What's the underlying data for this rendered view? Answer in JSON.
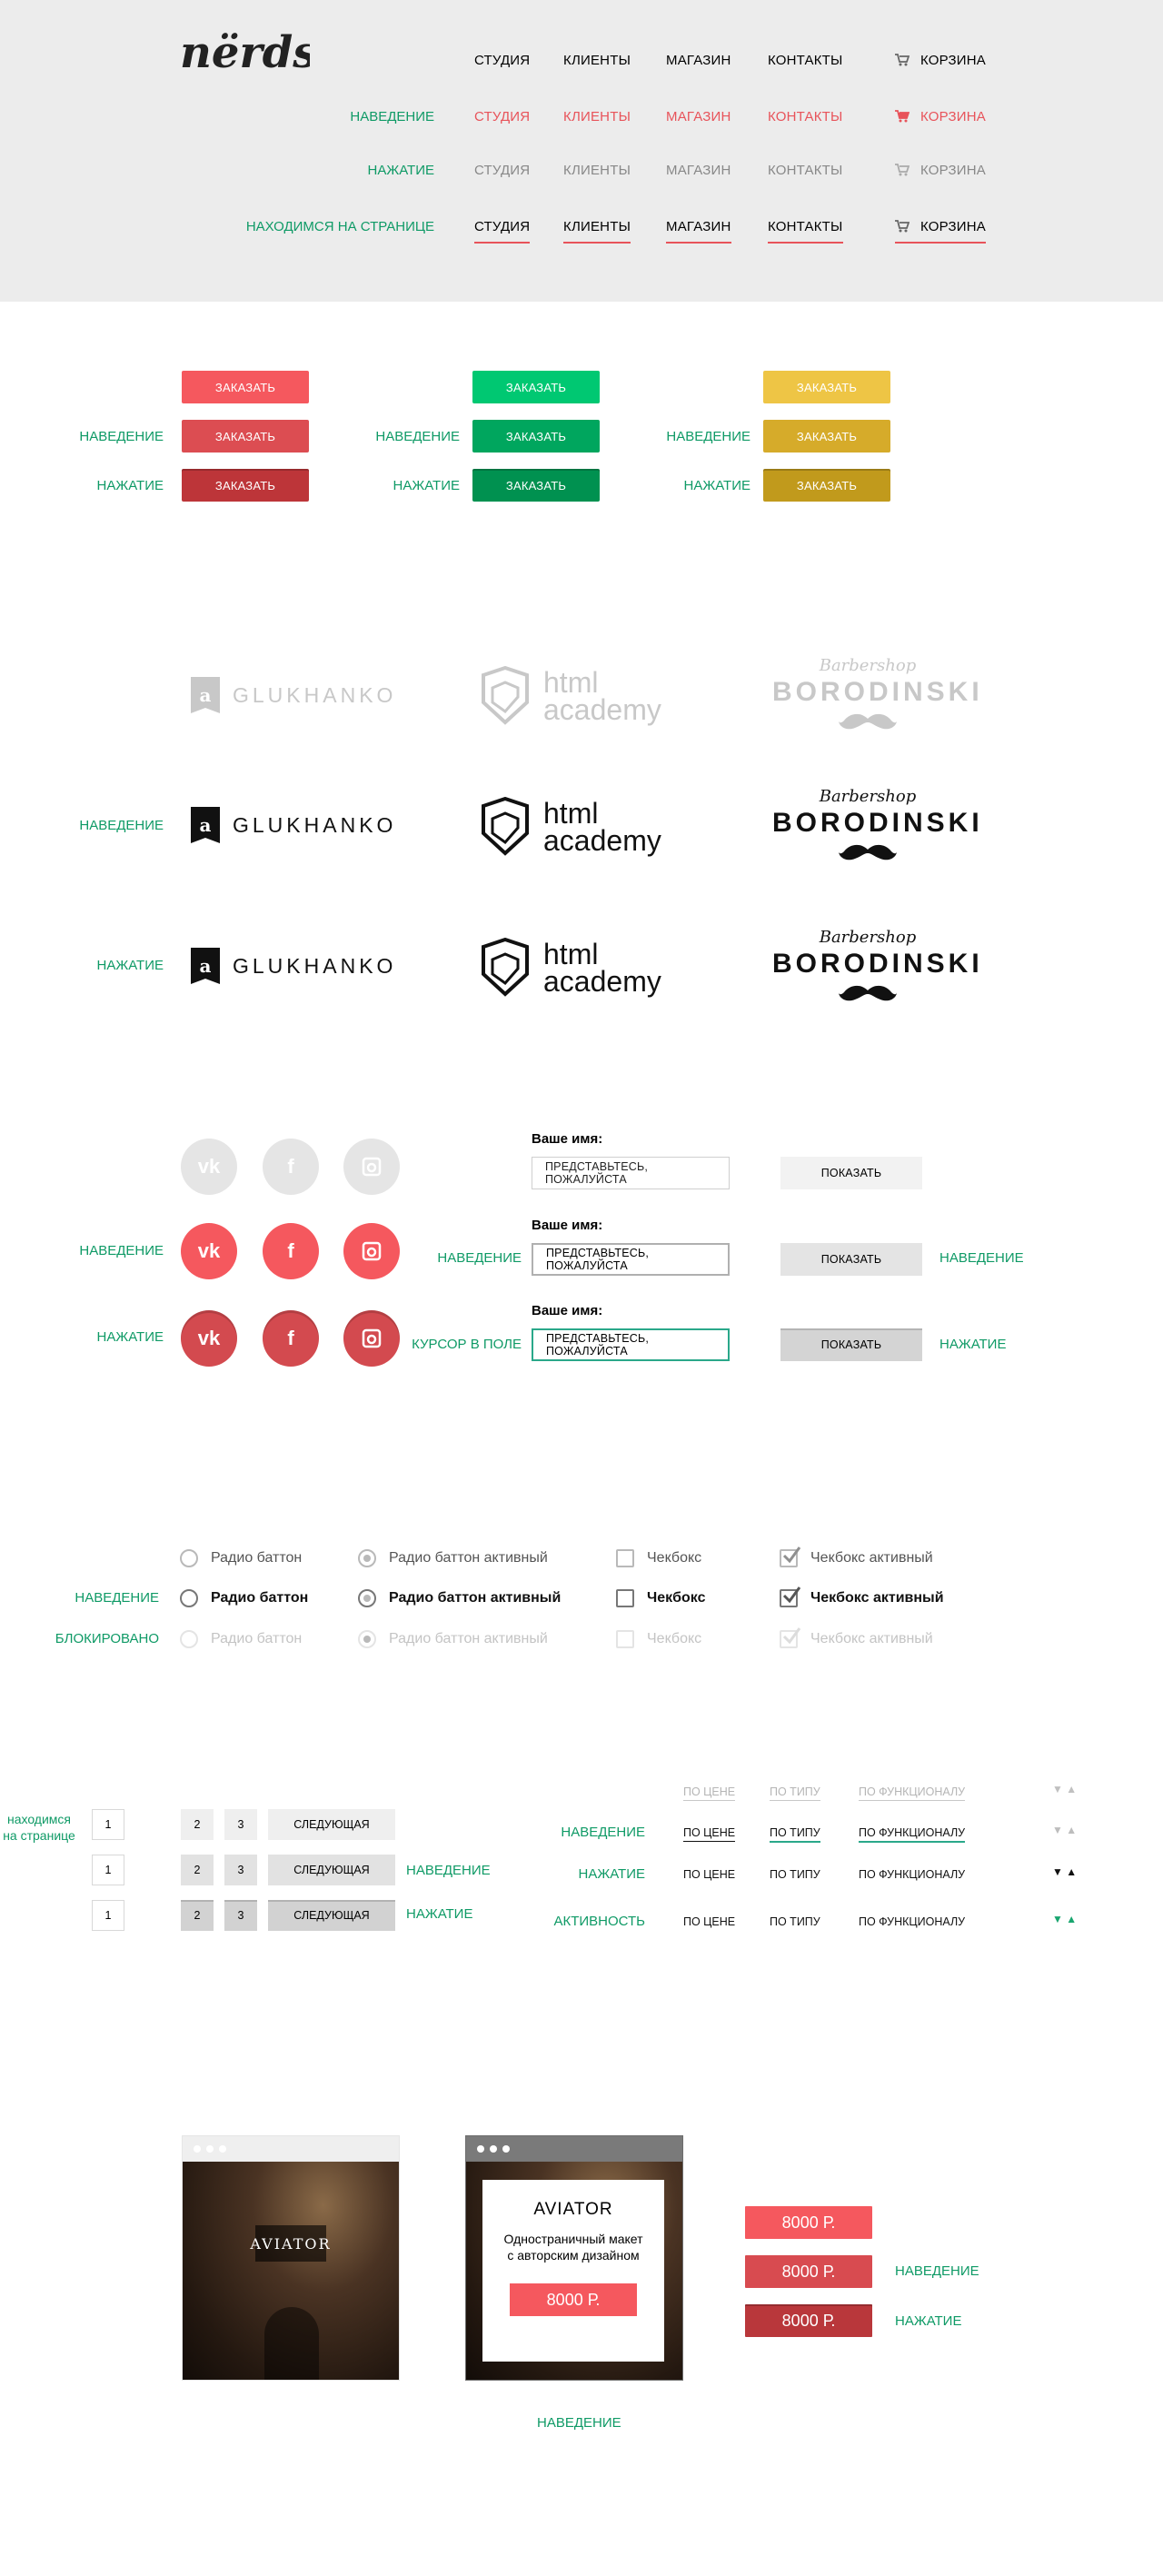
{
  "header": {
    "logo": "nërds",
    "nav": [
      "СТУДИЯ",
      "КЛИЕНТЫ",
      "МАГАЗИН",
      "КОНТАКТЫ"
    ],
    "cart": "КОРЗИНА",
    "states": [
      "НАВЕДЕНИЕ",
      "НАЖАТИЕ",
      "НАХОДИМСЯ НА СТРАНИЦЕ"
    ],
    "colors": {
      "bg": "#ececec",
      "accent": "#e8535a",
      "muted": "#888888"
    }
  },
  "buttons": {
    "label": "ЗАКАЗАТЬ",
    "states": [
      "НАВЕДЕНИЕ",
      "НАЖАТИЕ"
    ],
    "colors": {
      "red": [
        "#f5585e",
        "#dc4d52",
        "#bd3539"
      ],
      "green": [
        "#00c872",
        "#00a65e",
        "#009150"
      ],
      "yellow": [
        "#eec545",
        "#d6ab2a",
        "#c19a1c"
      ]
    }
  },
  "logos": {
    "glukhanko": "GLUKHANKO",
    "htmlacademy_1": "html",
    "htmlacademy_2": "academy",
    "boro_script": "Barbershop",
    "boro_name": "BORODINSKI",
    "states": [
      "НАВЕДЕНИЕ",
      "НАЖАТИЕ"
    ]
  },
  "social": {
    "vk": "vk",
    "fb": "f",
    "states": [
      "НАВЕДЕНИЕ",
      "НАЖАТИЕ"
    ],
    "colors": [
      "#e5e5e5",
      "#f5585e",
      "#d34a4f"
    ]
  },
  "form": {
    "label": "Ваше имя:",
    "placeholder": "ПРЕДСТАВЬТЕСЬ, ПОЖАЛУЙСТА",
    "submit": "ПОКАЗАТЬ",
    "states_left": [
      "НАВЕДЕНИЕ",
      "КУРСОР В ПОЛЕ"
    ],
    "states_right": [
      "НАВЕДЕНИЕ",
      "НАЖАТИЕ"
    ]
  },
  "controls": {
    "radio": "Радио баттон",
    "radio_active": "Радио баттон активный",
    "checkbox": "Чекбокс",
    "checkbox_active": "Чекбокс активный",
    "states": [
      "НАВЕДЕНИЕ",
      "БЛОКИРОВАНО"
    ]
  },
  "pagination": {
    "current_state_1": "находимся",
    "current_state_2": "на странице",
    "pages": [
      "1",
      "2",
      "3"
    ],
    "next": "СЛЕДУЮЩАЯ",
    "states": [
      "НАВЕДЕНИЕ",
      "НАЖАТИЕ"
    ]
  },
  "sorting": {
    "options": [
      "ПО ЦЕНЕ",
      "ПО ТИПУ",
      "ПО ФУНКЦИОНАЛУ"
    ],
    "states": [
      "НАВЕДЕНИЕ",
      "НАЖАТИЕ",
      "АКТИВНОСТЬ"
    ]
  },
  "catalog": {
    "title": "AVIATOR",
    "desc_1": "Одностраничный макет",
    "desc_2": "с авторским дизайном",
    "price": "8000 Р.",
    "states": [
      "НАВЕДЕНИЕ",
      "НАЖАТИЕ"
    ],
    "bottom_state": "НАВЕДЕНИЕ"
  }
}
